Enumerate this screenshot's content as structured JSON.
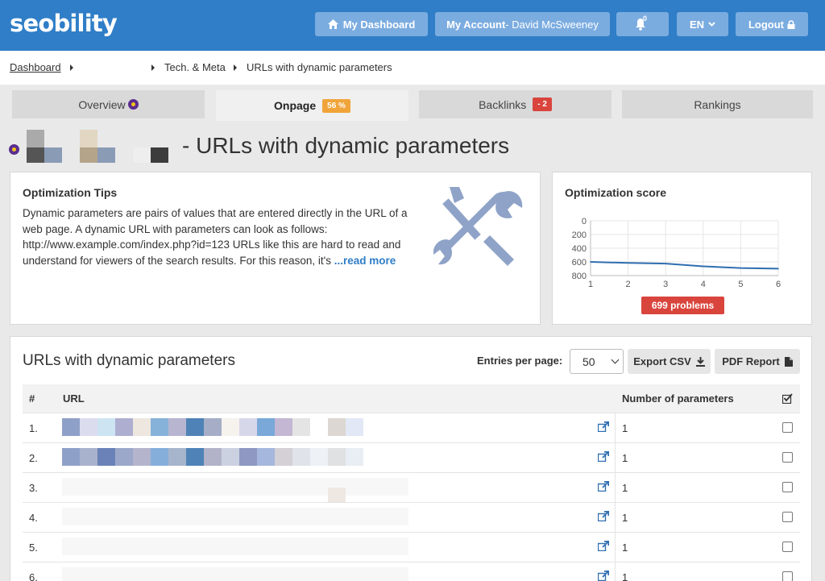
{
  "header": {
    "logo": "seobility",
    "my_dashboard": "My Dashboard",
    "my_account_label": "My Account",
    "my_account_user": " - David McSweeney",
    "notifications_count": "0",
    "language": "EN",
    "logout": "Logout"
  },
  "breadcrumb": {
    "dashboard": "Dashboard",
    "tech_meta": "Tech. & Meta",
    "current": "URLs with dynamic parameters"
  },
  "tabs": [
    {
      "label": "Overview"
    },
    {
      "label": "Onpage",
      "tag": "56 %"
    },
    {
      "label": "Backlinks",
      "tag": "- 2"
    },
    {
      "label": "Rankings"
    }
  ],
  "page_title": "- URLs with dynamic parameters",
  "tips": {
    "title": "Optimization Tips",
    "text": "Dynamic parameters are pairs of values that are entered directly in the URL of a web page. A dynamic URL with parameters can look as follows: http://www.example.com/index.php?id=123 URLs like this are hard to read and understand for viewers of the search results. For this reason, it's ",
    "read_more": "...read more"
  },
  "score": {
    "title": "Optimization score",
    "problems": "699 problems"
  },
  "chart_data": {
    "type": "line",
    "title": "",
    "x": [
      1,
      2,
      3,
      4,
      5,
      6
    ],
    "x_ticks": [
      "1",
      "2",
      "3",
      "4",
      "5",
      "6"
    ],
    "y_ticks": [
      "0",
      "200",
      "400",
      "600",
      "800"
    ],
    "ylim": [
      0,
      800
    ],
    "y_inverted": true,
    "grid": true,
    "series": [
      {
        "values": [
          600,
          615,
          625,
          665,
          690,
          699
        ]
      }
    ],
    "line_color": "#2f6eb0"
  },
  "table": {
    "section_title": "URLs with dynamic parameters",
    "entries_label": "Entries per page:",
    "entries_value": "50",
    "export_csv": "Export CSV",
    "pdf_report": "PDF Report",
    "col_num": "#",
    "col_url": "URL",
    "col_params": "Number of parameters",
    "rows": [
      {
        "num": "1.",
        "params": "1"
      },
      {
        "num": "2.",
        "params": "1"
      },
      {
        "num": "3.",
        "params": "1"
      },
      {
        "num": "4.",
        "params": "1"
      },
      {
        "num": "5.",
        "params": "1"
      },
      {
        "num": "6.",
        "params": "1"
      }
    ]
  },
  "colors": {
    "brand_blue": "#2f7ec7",
    "header_button": "#7bace0",
    "onpage_tag": "#f0a43a",
    "backlinks_tag": "#d9453d",
    "problems_badge": "#d9453d",
    "link": "#2f7ec7"
  }
}
